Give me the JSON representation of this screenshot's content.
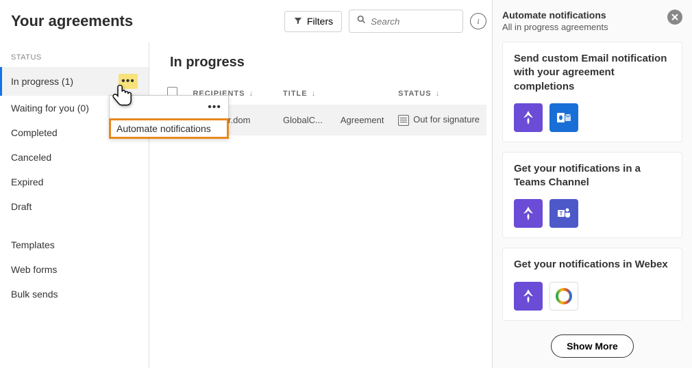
{
  "page_title": "Your agreements",
  "toolbar": {
    "filters": "Filters",
    "search_placeholder": "Search"
  },
  "sidebar": {
    "heading": "STATUS",
    "items": [
      {
        "label": "In progress (1)",
        "active": true
      },
      {
        "label": "Waiting for you (0)",
        "active": false
      },
      {
        "label": "Completed",
        "active": false
      },
      {
        "label": "Canceled",
        "active": false
      },
      {
        "label": "Expired",
        "active": false
      },
      {
        "label": "Draft",
        "active": false
      }
    ],
    "secondary": [
      {
        "label": "Templates"
      },
      {
        "label": "Web forms"
      },
      {
        "label": "Bulk sends"
      }
    ]
  },
  "automate_popup_label": "Automate notifications",
  "main": {
    "section_title": "In progress",
    "columns": {
      "recipients": "RECIPIENTS",
      "title": "TITLE",
      "status": "STATUS"
    },
    "rows": [
      {
        "recipients": "e@jupiter.dom",
        "title": "GlobalC...",
        "type": "Agreement",
        "status": "Out for signature"
      }
    ]
  },
  "panel": {
    "title": "Automate notifications",
    "subtitle": "All in progress agreements",
    "cards": [
      {
        "title": "Send custom Email notification with your agreement completions",
        "icons": [
          "acrobat",
          "outlook"
        ]
      },
      {
        "title": "Get your notifications in a Teams Channel",
        "icons": [
          "acrobat",
          "teams"
        ]
      },
      {
        "title": "Get your notifications in Webex",
        "icons": [
          "acrobat",
          "webex"
        ]
      }
    ],
    "showmore": "Show More"
  }
}
